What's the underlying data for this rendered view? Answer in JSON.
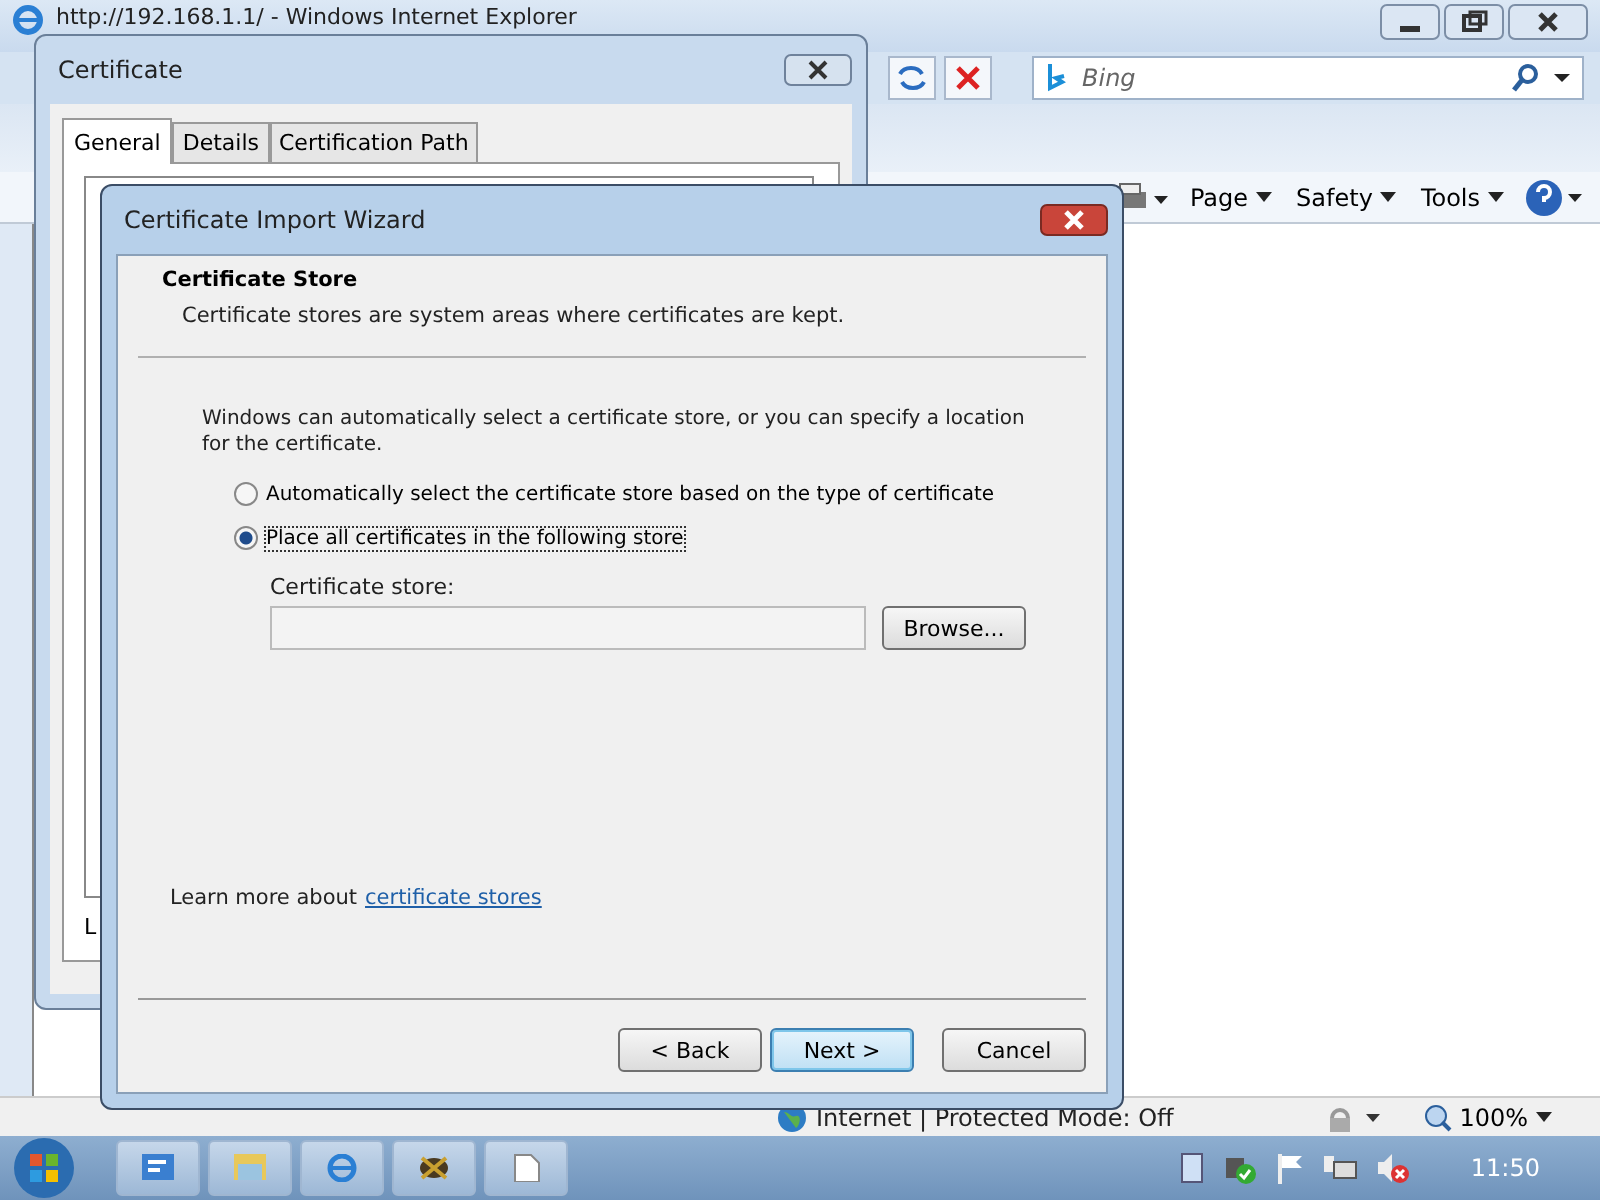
{
  "browser": {
    "title": "http://192.168.1.1/ - Windows Internet Explorer",
    "search": {
      "placeholder": "Bing"
    },
    "commands": [
      {
        "label": "Page"
      },
      {
        "label": "Safety"
      },
      {
        "label": "Tools"
      }
    ],
    "status": "Internet | Protected Mode: Off",
    "zoom": "100%"
  },
  "certificate": {
    "title": "Certificate",
    "tabs": [
      {
        "label": "General",
        "selected": true
      },
      {
        "label": "Details",
        "selected": false
      },
      {
        "label": "Certification Path",
        "selected": false
      }
    ],
    "footer_text": "L"
  },
  "wizard": {
    "title": "Certificate Import Wizard",
    "heading": "Certificate Store",
    "subheading": "Certificate stores are system areas where certificates are kept.",
    "intro": "Windows can automatically select a certificate store, or you can specify a location for the certificate.",
    "options": [
      {
        "label": "Automatically select the certificate store based on the type of certificate",
        "selected": false
      },
      {
        "label": "Place all certificates in the following store",
        "selected": true
      }
    ],
    "store_label": "Certificate store:",
    "browse": "Browse...",
    "learn_more": "Learn more about",
    "link": "certificate stores",
    "buttons": [
      {
        "label": "< Back",
        "default": false
      },
      {
        "label": "Next >",
        "default": true
      },
      {
        "label": "Cancel",
        "default": false
      }
    ]
  },
  "taskbar": {
    "clock": "11:50"
  }
}
